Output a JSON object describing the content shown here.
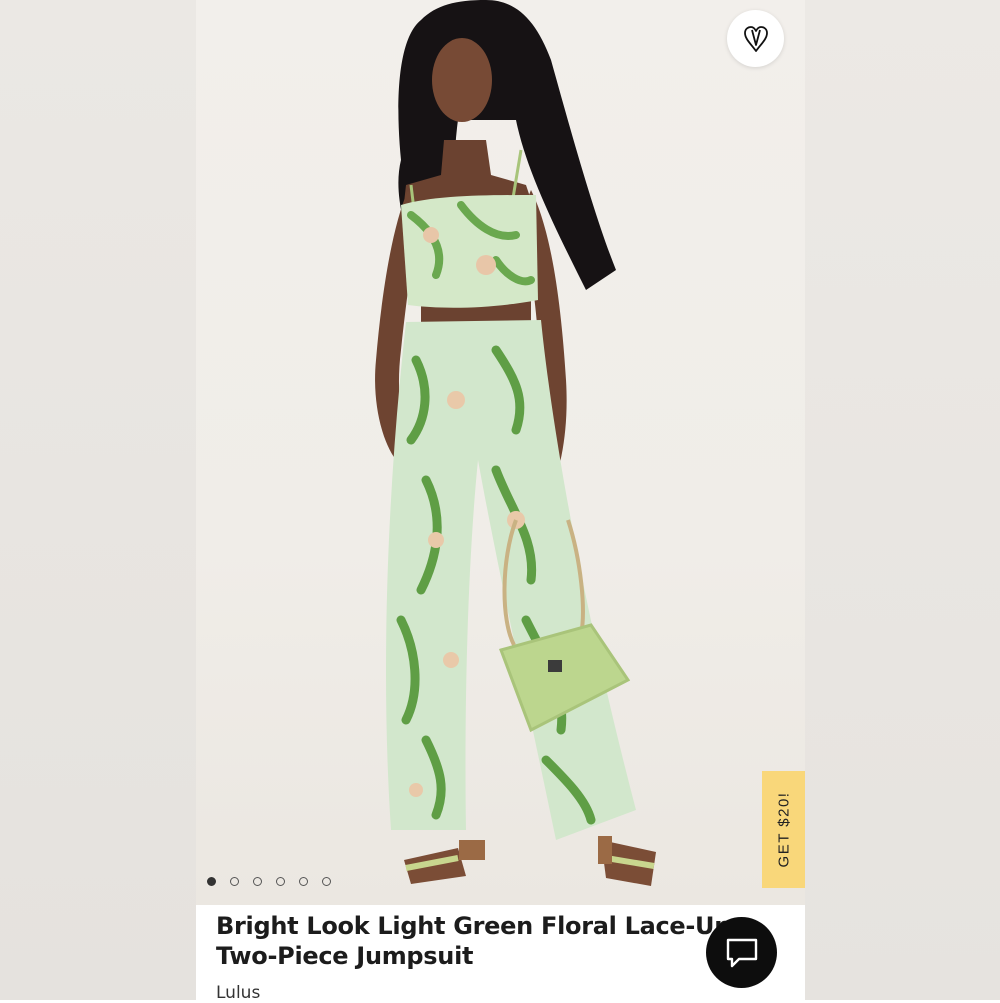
{
  "product": {
    "title": "Bright Look Light Green Floral Lace-Up Two-Piece Jumpsuit",
    "brand": "Lulus"
  },
  "promo": {
    "label": "GET $20!",
    "color": "#f9d77a"
  },
  "gallery": {
    "image_count": 6,
    "active_index": 0
  },
  "icons": {
    "favorite": "heart-icon",
    "chat": "chat-bubble-icon"
  }
}
